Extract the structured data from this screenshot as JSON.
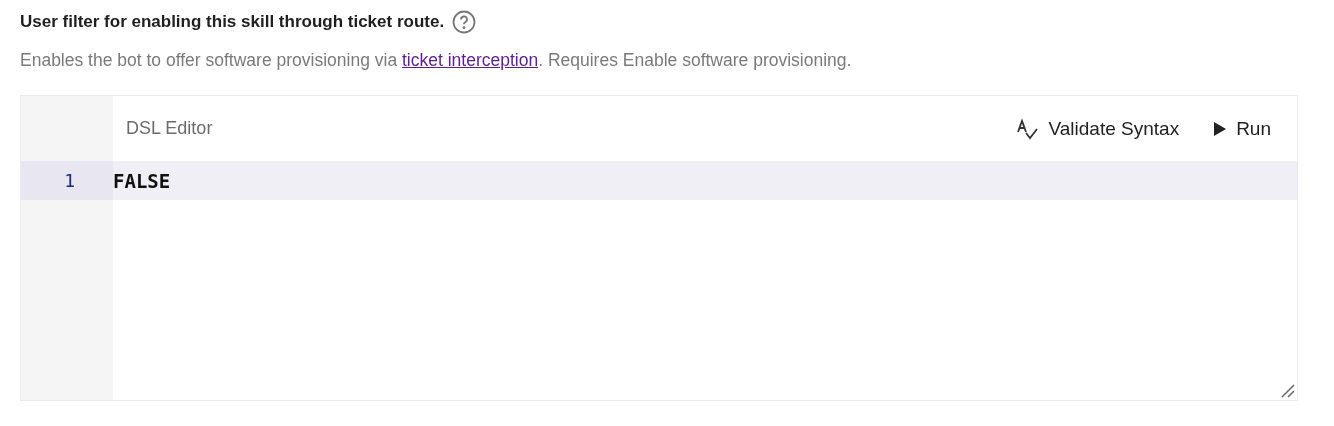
{
  "title": "User filter for enabling this skill through ticket route.",
  "description": {
    "before": "Enables the bot to offer software provisioning via ",
    "link": "ticket interception",
    "after": ". Requires Enable software provisioning."
  },
  "editor": {
    "title": "DSL Editor",
    "actions": [
      {
        "kind": "validate",
        "label": "Validate Syntax"
      },
      {
        "kind": "run",
        "label": "Run"
      }
    ],
    "lines": [
      {
        "number": "1",
        "code": "FALSE",
        "selected": true
      }
    ]
  }
}
